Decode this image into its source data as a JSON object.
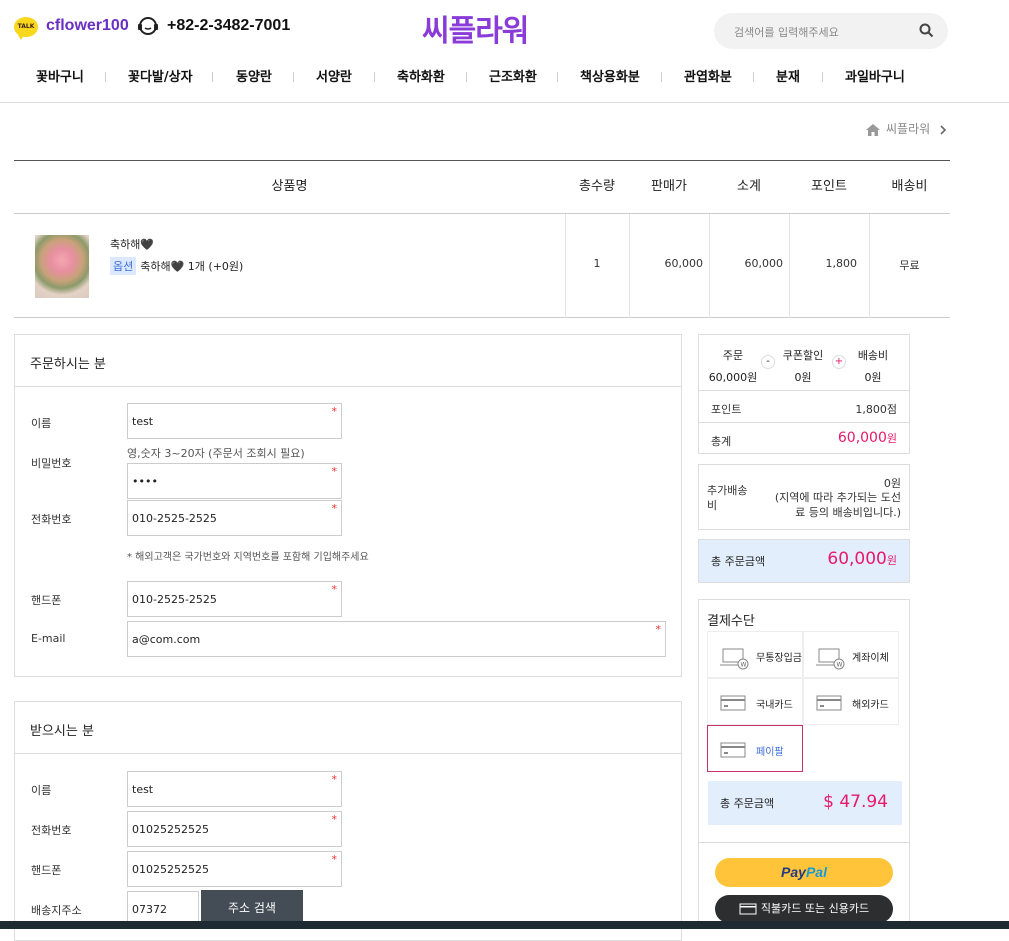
{
  "header": {
    "kakao_badge": "TALK",
    "kakao_id": "cflower100",
    "phone": "+82-2-3482-7001",
    "logo": "씨플라워",
    "search_placeholder": "검색어를 입력해주세요"
  },
  "nav": [
    "꽃바구니",
    "꽃다발/상자",
    "동양란",
    "서양란",
    "축하화환",
    "근조화환",
    "책상용화분",
    "관엽화분",
    "분재",
    "과일바구니"
  ],
  "breadcrumb": "씨플라워",
  "cart": {
    "headers": [
      "상품명",
      "총수량",
      "판매가",
      "소계",
      "포인트",
      "배송비"
    ],
    "item": {
      "name": "축하해🖤",
      "option_tag": "옵션",
      "option_text": "축하해🖤 1개 (+0원)",
      "qty": "1",
      "price": "60,000",
      "subtotal": "60,000",
      "points": "1,800",
      "shipping": "무료"
    }
  },
  "orderer": {
    "title": "주문하시는 분",
    "name_label": "이름",
    "name": "test",
    "password_label": "비밀번호",
    "password_hint": "영,숫자 3~20자 (주문서 조회시 필요)",
    "password": "••••",
    "tel_label": "전화번호",
    "tel": "010-2525-2525",
    "tel_note": "* 해외고객은 국가번호와 지역번호를 포함해 기입해주세요",
    "mobile_label": "핸드폰",
    "mobile": "010-2525-2525",
    "email_label": "E-mail",
    "email": "a@com.com"
  },
  "receiver": {
    "title": "받으시는 분",
    "name_label": "이름",
    "name": "test",
    "tel_label": "전화번호",
    "tel": "01025252525",
    "mobile_label": "핸드폰",
    "mobile": "01025252525",
    "addr_label": "배송지주소",
    "zip": "07372",
    "addr_button": "주소 검색"
  },
  "summary": {
    "order_label": "주문",
    "order_value": "60,000원",
    "coupon_label": "쿠폰할인",
    "coupon_value": "0원",
    "ship_label": "배송비",
    "ship_value": "0원",
    "minus": "-",
    "plus": "+",
    "point_label": "포인트",
    "point_value": "1,800점",
    "total_label": "총계",
    "total_value": "60,000",
    "total_unit": "원",
    "extra_label": "추가배송비",
    "extra_value": "0원",
    "extra_note": "(지역에 따라 추가되는 도선료 등의 배송비입니다.)",
    "grand_label": "총 주문금액",
    "grand_value": "60,000",
    "grand_unit": "원"
  },
  "payment": {
    "title": "결제수단",
    "methods": [
      "무통장입금",
      "계좌이체",
      "국내카드",
      "해외카드",
      "페이팔"
    ],
    "usd_label": "총 주문금액",
    "usd_value": "$ 47.94",
    "paypal_1": "Pay",
    "paypal_2": "Pal",
    "card_button": "직불카드 또는 신용카드"
  },
  "colors": {
    "accent": "#e6196d",
    "logo": "#8a3bd8",
    "selected": "#c4336d"
  }
}
